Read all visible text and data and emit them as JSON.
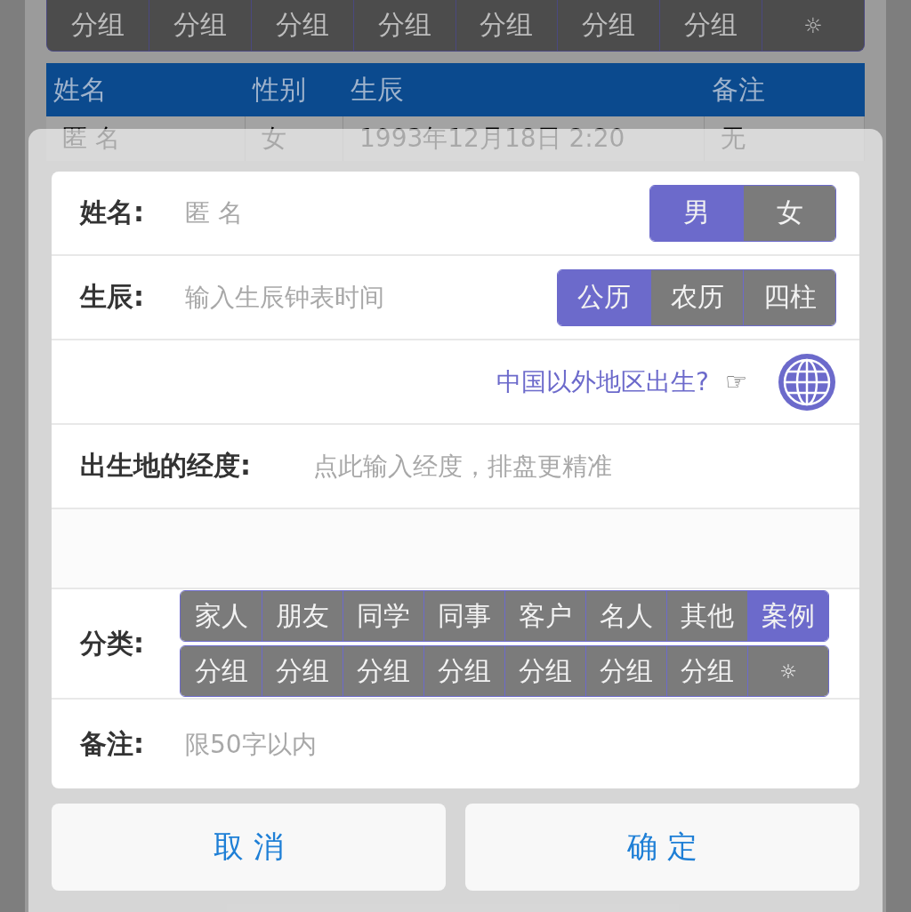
{
  "background": {
    "group_buttons": [
      "分组",
      "分组",
      "分组",
      "分组",
      "分组",
      "分组",
      "分组",
      "☼"
    ],
    "table": {
      "columns": [
        "姓名",
        "性别",
        "生辰",
        "备注"
      ],
      "rows": [
        [
          "匿 名",
          "女",
          "1993年12月18日 2:20",
          "无"
        ]
      ]
    }
  },
  "dialog": {
    "name": {
      "label": "姓名:",
      "placeholder": "匿 名",
      "genders": [
        {
          "label": "男",
          "selected": true
        },
        {
          "label": "女",
          "selected": false
        }
      ]
    },
    "birth": {
      "label": "生辰:",
      "placeholder": "输入生辰钟表时间",
      "calendars": [
        {
          "label": "公历",
          "selected": true
        },
        {
          "label": "农历",
          "selected": false
        },
        {
          "label": "四柱",
          "selected": false
        }
      ]
    },
    "abroad_link": "中国以外地区出生?",
    "pointer": "☞",
    "longitude": {
      "label": "出生地的经度:",
      "placeholder": "点此输入经度，排盘更精准"
    },
    "category": {
      "label": "分类:",
      "categories": [
        {
          "label": "家人",
          "selected": false
        },
        {
          "label": "朋友",
          "selected": false
        },
        {
          "label": "同学",
          "selected": false
        },
        {
          "label": "同事",
          "selected": false
        },
        {
          "label": "客户",
          "selected": false
        },
        {
          "label": "名人",
          "selected": false
        },
        {
          "label": "其他",
          "selected": false
        },
        {
          "label": "案例",
          "selected": true
        }
      ],
      "groups": [
        "分组",
        "分组",
        "分组",
        "分组",
        "分组",
        "分组",
        "分组",
        "☼"
      ]
    },
    "note": {
      "label": "备注:",
      "placeholder": "限50字以内"
    },
    "buttons": [
      "取 消",
      "确 定"
    ]
  }
}
